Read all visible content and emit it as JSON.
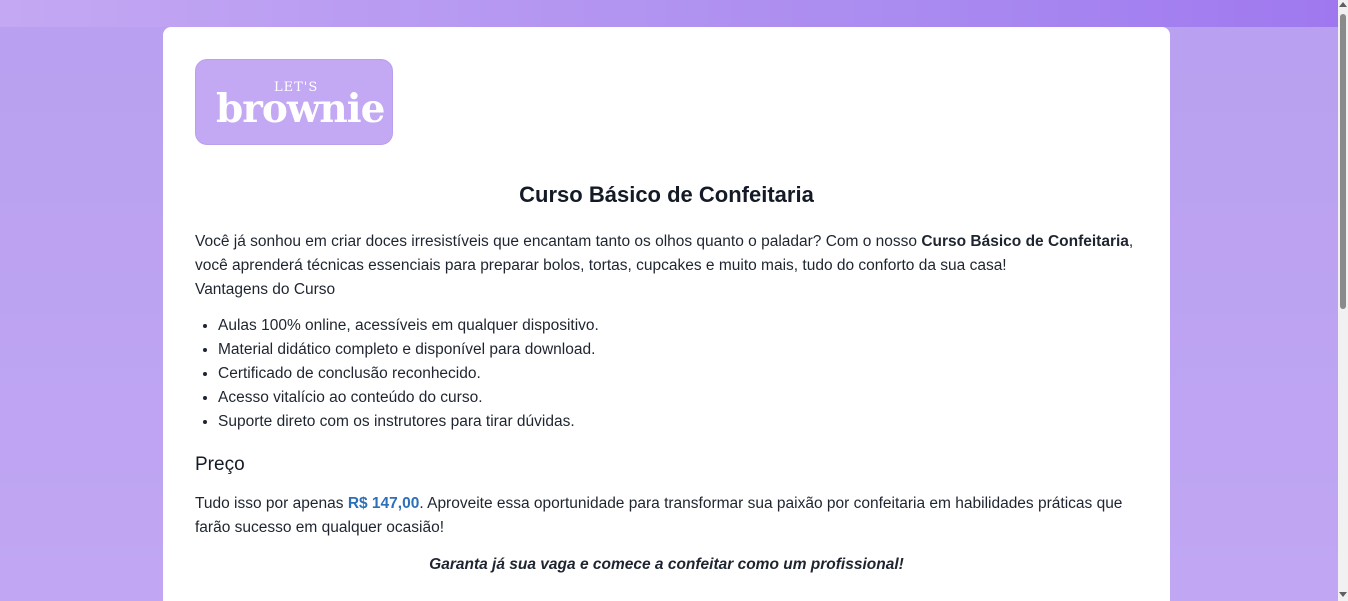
{
  "logo": {
    "small_text": "LET'S",
    "main_text": "brownie"
  },
  "page": {
    "title": "Curso Básico de Confeitaria",
    "intro_before": "Você já sonhou em criar doces irresistíveis que encantam tanto os olhos quanto o paladar? Com o nosso ",
    "intro_bold": "Curso Básico de Confeitaria",
    "intro_after": ", você aprenderá técnicas essenciais para preparar bolos, tortas, cupcakes e muito mais, tudo do conforto da sua casa!",
    "advantages_heading": "Vantagens do Curso",
    "advantages": [
      "Aulas 100% online, acessíveis em qualquer dispositivo.",
      "Material didático completo e disponível para download.",
      "Certificado de conclusão reconhecido.",
      "Acesso vitalício ao conteúdo do curso.",
      "Suporte direto com os instrutores para tirar dúvidas."
    ],
    "price_heading": "Preço",
    "price_before": "Tudo isso por apenas ",
    "price_value": "R$ 147,00",
    "price_after": ". Aproveite essa oportunidade para transformar sua paixão por confeitaria em habilidades práticas que farão sucesso em qualquer ocasião!",
    "cta": "Garanta já sua vaga e comece a confeitar como um profissional!"
  },
  "colors": {
    "background": "#c0a6f3",
    "logo_bg": "#c3a8f3",
    "price": "#2d6fb8",
    "text": "#1f2530"
  }
}
